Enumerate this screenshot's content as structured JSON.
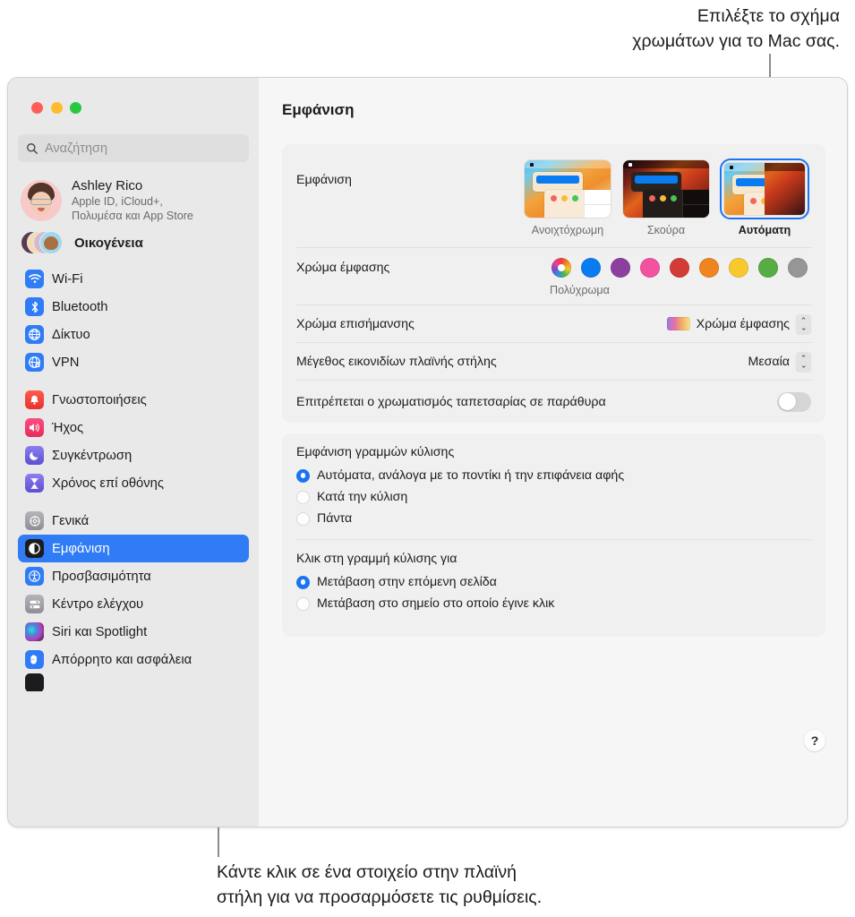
{
  "callouts": {
    "top": "Επιλέξτε το σχήμα\nχρωμάτων για το Mac σας.",
    "bottom": "Κάντε κλικ σε ένα στοιχείο στην πλαϊνή\nστήλη για να προσαρμόσετε τις ρυθμίσεις."
  },
  "sidebar": {
    "search": {
      "placeholder": "Αναζήτηση",
      "value": ""
    },
    "account": {
      "name": "Ashley Rico",
      "subtitle_line1": "Apple ID, iCloud+,",
      "subtitle_line2": "Πολυμέσα και App Store"
    },
    "family": {
      "label": "Οικογένεια"
    },
    "groups": [
      {
        "items": [
          {
            "label": "Wi-Fi",
            "icon": "wifi-icon",
            "color": "#2f7cf6",
            "selected": false
          },
          {
            "label": "Bluetooth",
            "icon": "bluetooth-icon",
            "color": "#2f7cf6",
            "selected": false
          },
          {
            "label": "Δίκτυο",
            "icon": "globe-icon",
            "color": "#2f7cf6",
            "selected": false
          },
          {
            "label": "VPN",
            "icon": "vpn-globe-icon",
            "color": "#2f7cf6",
            "selected": false
          }
        ]
      },
      {
        "items": [
          {
            "label": "Γνωστοποιήσεις",
            "icon": "bell-icon",
            "color": "#f0483e",
            "selected": false
          },
          {
            "label": "Ήχος",
            "icon": "speaker-icon",
            "color": "#f0386b",
            "selected": false
          },
          {
            "label": "Συγκέντρωση",
            "icon": "moon-icon",
            "color": "#6e63d8",
            "selected": false
          },
          {
            "label": "Χρόνος επί οθόνης",
            "icon": "hourglass-icon",
            "color": "#6e63d8",
            "selected": false
          }
        ]
      },
      {
        "items": [
          {
            "label": "Γενικά",
            "icon": "gear-icon",
            "color": "#8e8e93",
            "selected": false
          },
          {
            "label": "Εμφάνιση",
            "icon": "appearance-icon",
            "color": "#1c1c1e",
            "selected": true
          },
          {
            "label": "Προσβασιμότητα",
            "icon": "accessibility-icon",
            "color": "#2f7cf6",
            "selected": false
          },
          {
            "label": "Κέντρο ελέγχου",
            "icon": "control-center-icon",
            "color": "#8e8e93",
            "selected": false
          },
          {
            "label": "Siri και Spotlight",
            "icon": "siri-icon",
            "color": "#3a2a4a",
            "selected": false
          },
          {
            "label": "Απόρρητο και ασφάλεια",
            "icon": "hand-icon",
            "color": "#2f7cf6",
            "selected": false
          }
        ]
      }
    ]
  },
  "main": {
    "title": "Εμφάνιση",
    "appearance": {
      "label": "Εμφάνιση",
      "options": [
        {
          "label": "Ανοιχτόχρωμη",
          "selected": false
        },
        {
          "label": "Σκούρα",
          "selected": false
        },
        {
          "label": "Αυτόματη",
          "selected": true
        }
      ]
    },
    "accent": {
      "label": "Χρώμα έμφασης",
      "caption": "Πολύχρωμα",
      "swatches": [
        {
          "name": "multicolor",
          "color": "multi",
          "selected": true
        },
        {
          "name": "blue",
          "color": "#0a7cf2",
          "selected": false
        },
        {
          "name": "purple",
          "color": "#8c3f9e",
          "selected": false
        },
        {
          "name": "pink",
          "color": "#f2529f",
          "selected": false
        },
        {
          "name": "red",
          "color": "#d33b36",
          "selected": false
        },
        {
          "name": "orange",
          "color": "#ef8420",
          "selected": false
        },
        {
          "name": "yellow",
          "color": "#f8c92f",
          "selected": false
        },
        {
          "name": "green",
          "color": "#57ac45",
          "selected": false
        },
        {
          "name": "graphite",
          "color": "#969696",
          "selected": false
        }
      ]
    },
    "highlight": {
      "label": "Χρώμα επισήμανσης",
      "value": "Χρώμα έμφασης"
    },
    "sidebar_icon_size": {
      "label": "Μέγεθος εικονιδίων πλαϊνής στήλης",
      "value": "Μεσαία"
    },
    "wallpaper_tinting": {
      "label": "Επιτρέπεται ο χρωματισμός ταπετσαρίας σε παράθυρα",
      "state": "off"
    },
    "show_scrollbars": {
      "title": "Εμφάνιση γραμμών κύλισης",
      "options": [
        {
          "label": "Αυτόματα, ανάλογα με το ποντίκι ή την επιφάνεια αφής",
          "selected": true
        },
        {
          "label": "Κατά την κύλιση",
          "selected": false
        },
        {
          "label": "Πάντα",
          "selected": false
        }
      ]
    },
    "click_scrollbar": {
      "title": "Κλικ στη γραμμή κύλισης για",
      "options": [
        {
          "label": "Μετάβαση στην επόμενη σελίδα",
          "selected": true
        },
        {
          "label": "Μετάβαση στο σημείο στο οποίο έγινε κλικ",
          "selected": false
        }
      ]
    },
    "help_label": "?"
  }
}
